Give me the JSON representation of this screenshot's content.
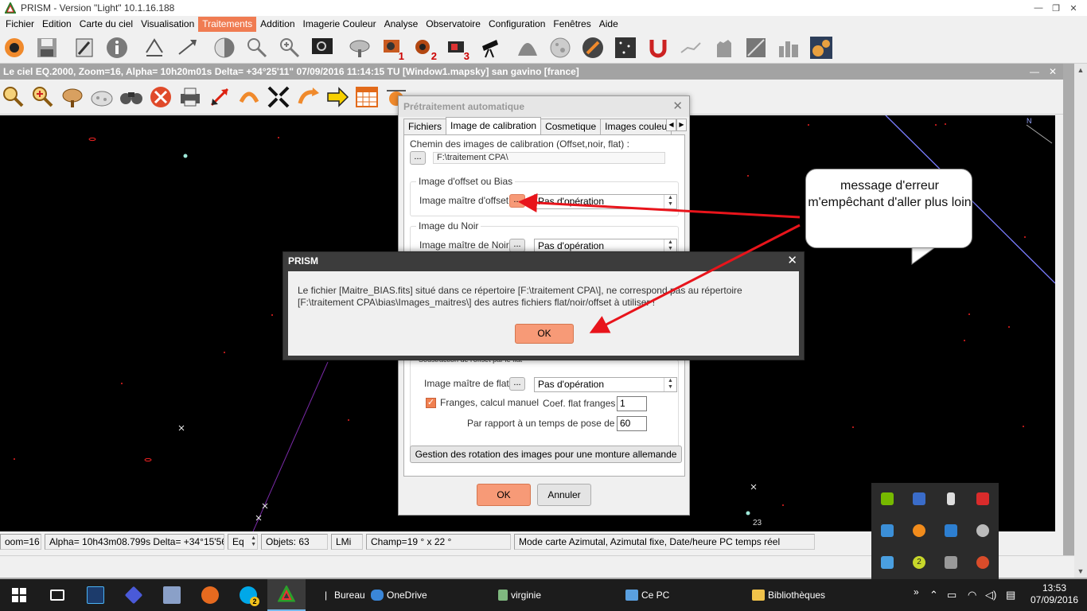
{
  "app": {
    "title": "PRISM - Version \"Light\"  10.1.16.188",
    "window_controls": [
      "—",
      "❐",
      "✕"
    ]
  },
  "menu": [
    "Fichier",
    "Edition",
    "Carte du ciel",
    "Visualisation",
    "Traitements",
    "Addition",
    "Imagerie Couleur",
    "Analyse",
    "Observatoire",
    "Configuration",
    "Fenêtres",
    "Aide"
  ],
  "toolbar1_badges": [
    "1",
    "2",
    "3"
  ],
  "sky_window": {
    "title": "Le ciel EQ.2000, Zoom=16, Alpha= 10h20m01s Delta= +34°25'11\"     07/09/2016 11:14:15 TU [Window1.mapsky]   san gavino [france]",
    "controls": [
      "—",
      "✕"
    ],
    "map_label_north": "N",
    "map_label_23": "23"
  },
  "status": {
    "zoom": "oom=16",
    "coords": "Alpha= 10h43m08.799s Delta= +34°15'56.53\"",
    "frame": "Eq",
    "objects": "Objets: 63",
    "lmi": "LMi",
    "field": "Champ=19 ° x 22 °",
    "mode": "Mode carte Azimutal, Azimutal fixe, Date/heure PC temps réel"
  },
  "pretraitement": {
    "title": "Prétraitement automatique",
    "tabs": [
      "Fichiers",
      "Image de calibration",
      "Cosmetique",
      "Images couleurs Af"
    ],
    "path_label": "Chemin des images de calibration (Offset,noir, flat) :",
    "browse": "...",
    "path_value": "F:\\traitement CPA\\",
    "offset_group": "Image d'offset ou Bias",
    "offset_label": "Image maître d'offset :",
    "offset_value": "Pas d'opération",
    "noir_group": "Image du Noir",
    "noir_label": "Image maître de Noir :",
    "noir_value": "Pas d'opération",
    "flat_group_partial": "Soustraction de l'offset par le flat",
    "flat_label": "Image maître de flat :",
    "flat_value": "Pas d'opération",
    "franges_label": "Franges, calcul manuel",
    "franges_checked": "✓",
    "coef_label": "Coef. flat franges :",
    "coef_value": "1",
    "pose_label": "Par rapport à un temps de pose de (s) :",
    "pose_value": "60",
    "rotation_button": "Gestion des rotation des images pour une monture allemande",
    "ok": "OK",
    "cancel": "Annuler"
  },
  "msgbox": {
    "title": "PRISM",
    "text": "Le fichier [Maitre_BIAS.fits] situé dans ce répertoire [F:\\traitement CPA\\], ne correspond pas au répertoire [F:\\traitement CPA\\bias\\Images_maitres\\] des autres fichiers flat/noir/offset à utiliser !",
    "ok": "OK"
  },
  "callout": {
    "text": "message d'erreur m'empêchant d'aller plus loin"
  },
  "taskbar": {
    "bureau": "Bureau",
    "onedrive": "OneDrive",
    "user": "virginie",
    "pc": "Ce PC",
    "libraries": "Bibliothèques",
    "time": "13:53",
    "date": "07/09/2016",
    "skype_badge": "2",
    "tray_badge": "2",
    "overflow": "»"
  },
  "colors": {
    "accent": "#f07c52",
    "button_hot": "#f79a77",
    "annotation_arrow": "#e8141b",
    "sky_background": "#000000"
  }
}
